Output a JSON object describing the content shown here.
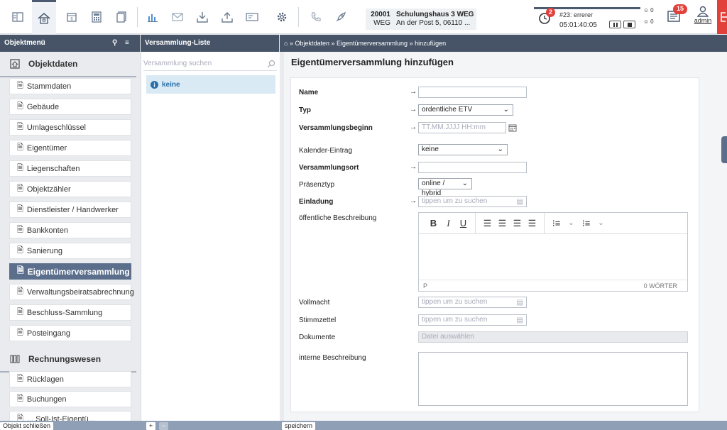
{
  "colors": {
    "header_bg": "#475468",
    "accent": "#5b6f8c",
    "link": "#2a6fa8",
    "badge": "#e2403b"
  },
  "toolbar": {
    "icons": [
      "home-panel-icon",
      "home-icon",
      "calendar-icon",
      "calculator-icon",
      "documents-icon",
      "chart-icon",
      "mail-icon",
      "download-icon",
      "upload-icon",
      "ticket-icon",
      "gear-icon",
      "phone-icon",
      "rocket-icon"
    ],
    "object": {
      "number": "20001",
      "type": "WEG",
      "name": "Schulungshaus 3 WEG",
      "address": "An der Post 5, 06110 ..."
    },
    "timer": {
      "badge": "2",
      "ticket": "#23: errerer",
      "time": "05:01:40:05"
    },
    "status_counts": [
      "0",
      "0"
    ],
    "notifications": "15",
    "user": "admin"
  },
  "headers": {
    "sidebar": "Objektmenü",
    "list": "Versammlung-Liste",
    "breadcrumb": [
      "Objektdaten",
      "Eigentümerversammlung",
      "hinzufügen"
    ]
  },
  "sidebar": {
    "section1": "Objektdaten",
    "items": [
      "Stammdaten",
      "Gebäude",
      "Umlageschlüssel",
      "Eigentümer",
      "Liegenschaften",
      "Objektzähler",
      "Dienstleister / Handwerker",
      "Bankkonten",
      "Sanierung",
      "Eigentümerversammlung",
      "Verwaltungsbeiratsabrechnung",
      "Beschluss-Sammlung",
      "Posteingang"
    ],
    "active_index": 9,
    "section2": "Rechnungswesen",
    "items2": [
      "Rücklagen",
      "Buchungen",
      "... Soll-Ist-Eigentü..."
    ]
  },
  "list": {
    "search_placeholder": "Versammlung suchen",
    "items": [
      "keine"
    ]
  },
  "form": {
    "title": "Eigentümerversammlung hinzufügen",
    "name_label": "Name",
    "typ_label": "Typ",
    "typ_value": "ordentliche ETV",
    "beginn_label": "Versammlungsbeginn",
    "beginn_placeholder": "TT.MM.JJJJ HH:mm",
    "kalender_label": "Kalender-Eintrag",
    "kalender_value": "keine",
    "ort_label": "Versammlungsort",
    "praesenz_label": "Präsenztyp",
    "praesenz_value": "online / hybrid",
    "einladung_label": "Einladung",
    "search_placeholder": "tippen um zu suchen",
    "beschreibung_label": "öffentliche Beschreibung",
    "editor": {
      "tools": [
        "B",
        "I",
        "U"
      ],
      "path": "P",
      "wordcount": "0 WÖRTER"
    },
    "vollmacht_label": "Vollmacht",
    "stimmzettel_label": "Stimmzettel",
    "dokumente_label": "Dokumente",
    "dokumente_placeholder": "Datei auswählen",
    "intern_label": "interne Beschreibung"
  },
  "bottom": {
    "close": "Objekt schließen",
    "add": "+",
    "remove": "−",
    "save": "speichern"
  }
}
